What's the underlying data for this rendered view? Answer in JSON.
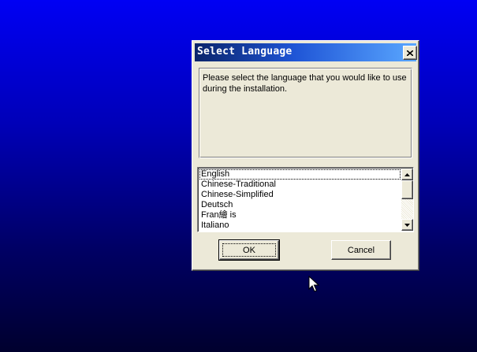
{
  "dialog": {
    "title": "Select Language",
    "close_icon": "close-icon",
    "message": "Please select the language that you would like to use during the installation."
  },
  "language_list": {
    "items": [
      "English",
      "Chinese-Traditional",
      "Chinese-Simplified",
      "Deutsch",
      "Fran繪 is",
      "Italiano"
    ],
    "selected": "English",
    "scroll_up_icon": "arrow-up-icon",
    "scroll_down_icon": "arrow-down-icon"
  },
  "buttons": {
    "ok_label": "OK",
    "cancel_label": "Cancel"
  },
  "colors": {
    "desktop_top": "#0000f4",
    "desktop_bottom": "#00002e",
    "titlebar_start": "#0a246a",
    "titlebar_end": "#5aa7ff",
    "dialog_face": "#ece9d8"
  },
  "cursor_icon": "mouse-pointer-icon"
}
